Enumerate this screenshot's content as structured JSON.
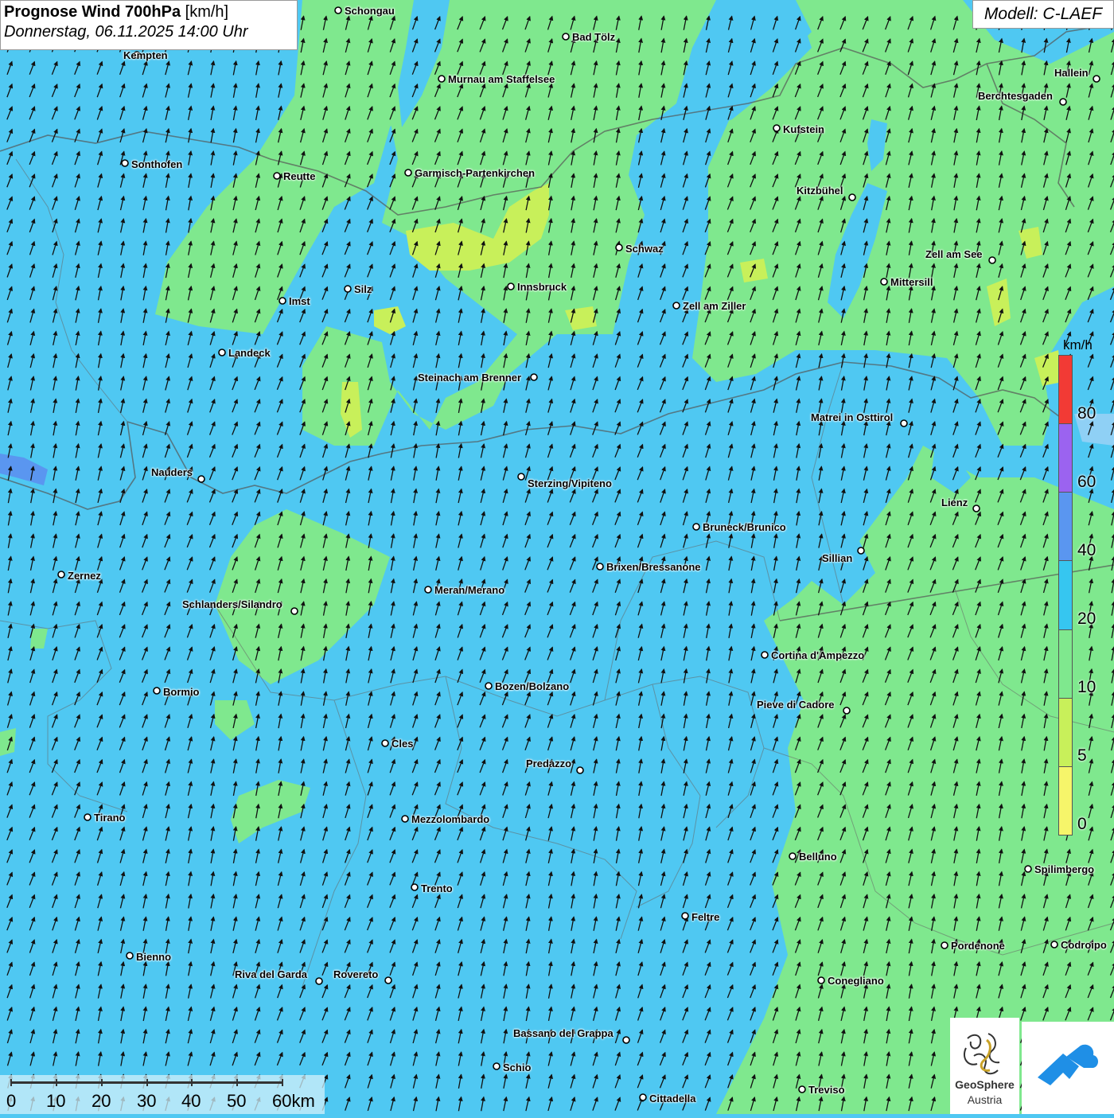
{
  "title": {
    "main": "Prognose Wind 700hPa",
    "unit": "[km/h]",
    "datetime": "Donnerstag, 06.11.2025 14:00 Uhr"
  },
  "model": "Modell: C-LAEF",
  "legend": {
    "unit": "km/h",
    "ticks": [
      "80",
      "60",
      "40",
      "20",
      "10",
      "5",
      "0"
    ],
    "colors": [
      "#f23a35",
      "#9b63f0",
      "#5a96f0",
      "#36c6f0",
      "#7fe88e",
      "#c8f05a",
      "#f6f56a"
    ]
  },
  "scale_bar": {
    "labels": [
      "0",
      "10",
      "20",
      "30",
      "40",
      "50",
      "60km"
    ]
  },
  "places": [
    {
      "name": "Schongau"
    },
    {
      "name": "Kempten"
    },
    {
      "name": "Bad Tölz"
    },
    {
      "name": "Murnau am Staffelsee"
    },
    {
      "name": "Hallein"
    },
    {
      "name": "Berchtesgaden"
    },
    {
      "name": "Kufstein"
    },
    {
      "name": "Sonthofen"
    },
    {
      "name": "Reutte"
    },
    {
      "name": "Garmisch-Partenkirchen"
    },
    {
      "name": "Kitzbühel"
    },
    {
      "name": "Schwaz"
    },
    {
      "name": "Zell am See"
    },
    {
      "name": "Mittersill"
    },
    {
      "name": "Silz"
    },
    {
      "name": "Innsbruck"
    },
    {
      "name": "Imst"
    },
    {
      "name": "Zell am Ziller"
    },
    {
      "name": "Landeck"
    },
    {
      "name": "Steinach am Brenner"
    },
    {
      "name": "Matrei in Osttirol"
    },
    {
      "name": "Nauders"
    },
    {
      "name": "Sterzing/Vipiteno"
    },
    {
      "name": "Lienz"
    },
    {
      "name": "Bruneck/Brunico"
    },
    {
      "name": "Sillian"
    },
    {
      "name": "Brixen/Bressanone"
    },
    {
      "name": "Zernez"
    },
    {
      "name": "Meran/Merano"
    },
    {
      "name": "Schlanders/Silandro"
    },
    {
      "name": "Cortina d'Ampezzo"
    },
    {
      "name": "Bormio"
    },
    {
      "name": "Bozen/Bolzano"
    },
    {
      "name": "Pieve di Cadore"
    },
    {
      "name": "Cles"
    },
    {
      "name": "Predazzo"
    },
    {
      "name": "Tirano"
    },
    {
      "name": "Mezzolombardo"
    },
    {
      "name": "Belluno"
    },
    {
      "name": "Spilimbergo"
    },
    {
      "name": "Trento"
    },
    {
      "name": "Feltre"
    },
    {
      "name": "Pordenone"
    },
    {
      "name": "Codroipo"
    },
    {
      "name": "Bienno"
    },
    {
      "name": "Riva del Garda"
    },
    {
      "name": "Rovereto"
    },
    {
      "name": "Conegliano"
    },
    {
      "name": "Bassano del Grappa"
    },
    {
      "name": "Schio"
    },
    {
      "name": "Treviso"
    },
    {
      "name": "Cittadella"
    }
  ],
  "logos": {
    "geosphere_line1": "GeoSphere",
    "geosphere_line2": "Austria"
  },
  "colors": {
    "wind_10_20": "#7fe88e",
    "wind_20_40": "#4fc8f2",
    "wind_5_10": "#c8f05a",
    "wind_40_60": "#5a96f0"
  }
}
